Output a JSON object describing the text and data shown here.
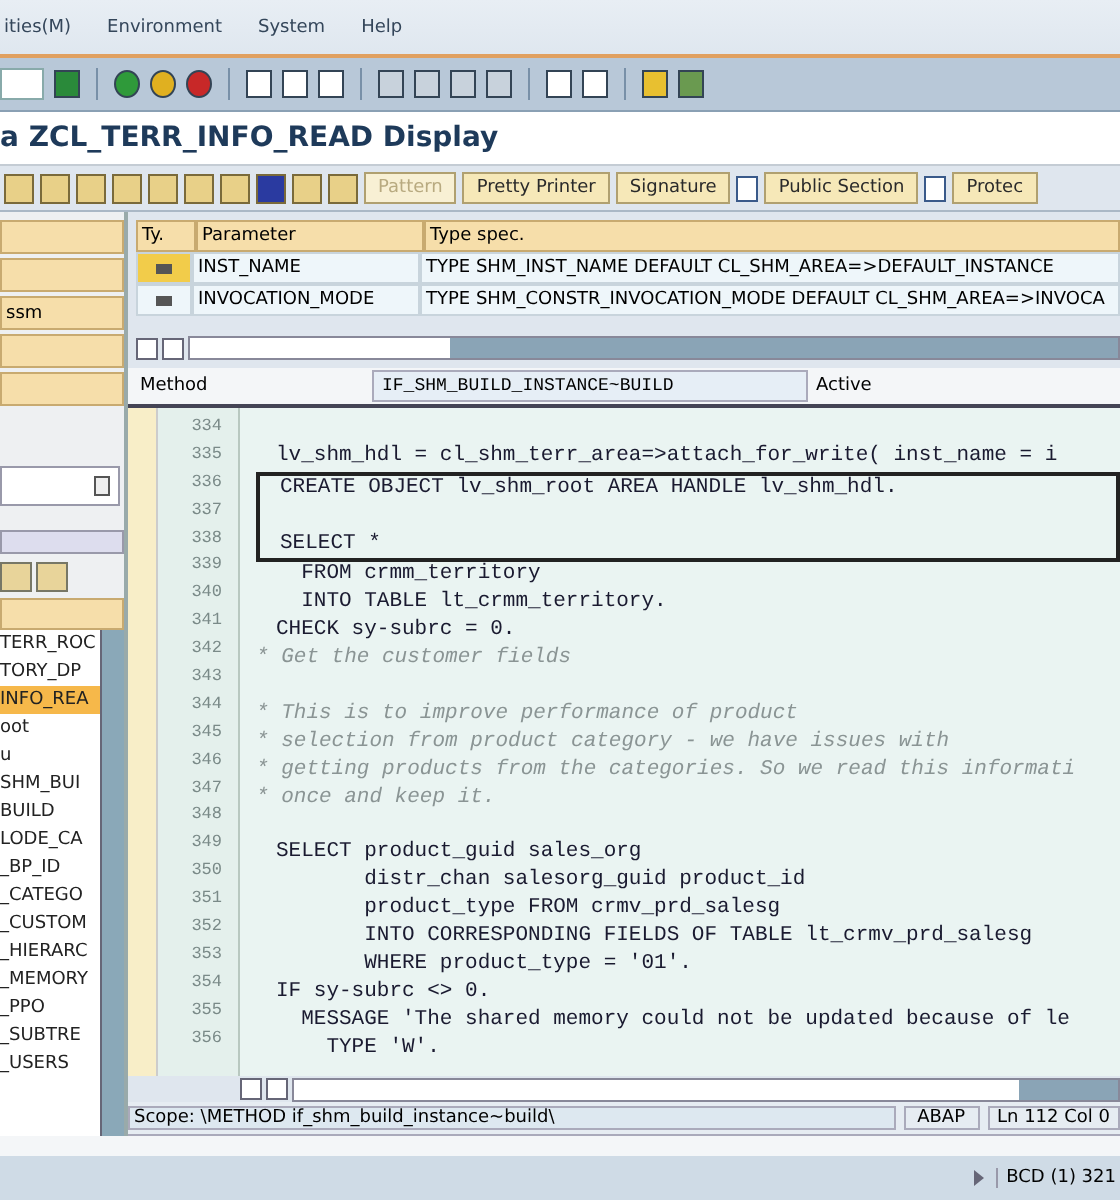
{
  "menu": [
    "ities(M)",
    "Environment",
    "System",
    "Help"
  ],
  "title": "a ZCL_TERR_INFO_READ Display",
  "app_toolbar": [
    {
      "label": "Pattern",
      "disabled": true,
      "kind": "text"
    },
    {
      "label": "Pretty Printer",
      "disabled": false,
      "kind": "text"
    },
    {
      "label": "Signature",
      "disabled": false,
      "kind": "text"
    },
    {
      "label": "Public Section",
      "disabled": false,
      "kind": "section"
    },
    {
      "label": "Protec",
      "disabled": false,
      "kind": "section"
    }
  ],
  "left_panel": {
    "tabs": [
      {
        "label": "ssm"
      }
    ],
    "tree": [
      {
        "label": "TERR_ROC",
        "selected": false
      },
      {
        "label": "TORY_DP",
        "selected": false
      },
      {
        "label": "INFO_REA",
        "selected": true
      },
      {
        "label": "oot",
        "selected": false
      },
      {
        "label": "u",
        "selected": false
      },
      {
        "label": "SHM_BUI",
        "selected": false
      },
      {
        "label": "BUILD",
        "selected": false
      },
      {
        "label": "LODE_CA",
        "selected": false
      },
      {
        "label": "_BP_ID",
        "selected": false
      },
      {
        "label": "_CATEGO",
        "selected": false
      },
      {
        "label": "_CUSTOM",
        "selected": false
      },
      {
        "label": "_HIERARC",
        "selected": false
      },
      {
        "label": "_MEMORY",
        "selected": false
      },
      {
        "label": "_PPO",
        "selected": false
      },
      {
        "label": "_SUBTRE",
        "selected": false
      },
      {
        "label": "_USERS",
        "selected": false
      }
    ]
  },
  "parameters": {
    "columns": [
      "Ty.",
      "Parameter",
      "Type spec."
    ],
    "rows": [
      {
        "parameter": "INST_NAME",
        "type_spec": "TYPE SHM_INST_NAME  DEFAULT CL_SHM_AREA=>DEFAULT_INSTANCE",
        "selected": true
      },
      {
        "parameter": "INVOCATION_MODE",
        "type_spec": "TYPE SHM_CONSTR_INVOCATION_MODE  DEFAULT CL_SHM_AREA=>INVOCA",
        "selected": false
      }
    ]
  },
  "method": {
    "label": "Method",
    "value": "IF_SHM_BUILD_INSTANCE~BUILD",
    "status": "Active"
  },
  "code": [
    {
      "num": "334",
      "kind": "code",
      "boxed": false
    },
    {
      "num": "335",
      "text": "lv_shm_hdl = cl_shm_terr_area=>attach_for_write( inst_name = i",
      "kind": "code",
      "boxed": false
    },
    {
      "num": "336",
      "text": "CREATE OBJECT lv_shm_root AREA HANDLE lv_shm_hdl.",
      "kind": "code",
      "boxed": true
    },
    {
      "num": "337",
      "kind": "code",
      "boxed": true
    },
    {
      "num": "338",
      "text": "SELECT *",
      "kind": "code",
      "boxed": true
    },
    {
      "num": "339",
      "text": "  FROM crmm_territory",
      "kind": "code",
      "boxed": false
    },
    {
      "num": "340",
      "text": "  INTO TABLE lt_crmm_territory.",
      "kind": "code",
      "boxed": false
    },
    {
      "num": "341",
      "text": "CHECK sy-subrc = 0.",
      "kind": "code",
      "boxed": false
    },
    {
      "num": "342",
      "text": "* Get the customer fields",
      "kind": "comment",
      "boxed": false
    },
    {
      "num": "343",
      "kind": "code",
      "boxed": false
    },
    {
      "num": "344",
      "text": "* This is to improve performance of product",
      "kind": "comment",
      "boxed": false
    },
    {
      "num": "345",
      "text": "* selection from product category - we have issues with",
      "kind": "comment",
      "boxed": false
    },
    {
      "num": "346",
      "text": "* getting products from the categories. So we read this informati",
      "kind": "comment",
      "boxed": false
    },
    {
      "num": "347",
      "text": "* once and keep it.",
      "kind": "comment",
      "boxed": false
    },
    {
      "num": "348",
      "kind": "code",
      "boxed": false
    },
    {
      "num": "349",
      "text": "SELECT product_guid sales_org",
      "kind": "code",
      "boxed": false
    },
    {
      "num": "350",
      "text": "       distr_chan salesorg_guid product_id",
      "kind": "code",
      "boxed": false
    },
    {
      "num": "351",
      "text": "       product_type FROM crmv_prd_salesg",
      "kind": "code",
      "boxed": false
    },
    {
      "num": "352",
      "text": "       INTO CORRESPONDING FIELDS OF TABLE lt_crmv_prd_salesg",
      "kind": "code",
      "boxed": false
    },
    {
      "num": "353",
      "text": "       WHERE product_type = '01'.",
      "kind": "code",
      "boxed": false
    },
    {
      "num": "354",
      "text": "IF sy-subrc <> 0.",
      "kind": "code",
      "boxed": false
    },
    {
      "num": "355",
      "text": "  MESSAGE 'The shared memory could not be updated because of le",
      "kind": "code",
      "boxed": false
    },
    {
      "num": "356",
      "text": "    TYPE 'W'.",
      "kind": "code",
      "boxed": false
    }
  ],
  "editor_status": {
    "scope": "Scope: \\METHOD if_shm_build_instance~build\\",
    "language": "ABAP",
    "position": "Ln 112 Col  0"
  },
  "status_bar": {
    "system": "BCD (1) 321"
  }
}
